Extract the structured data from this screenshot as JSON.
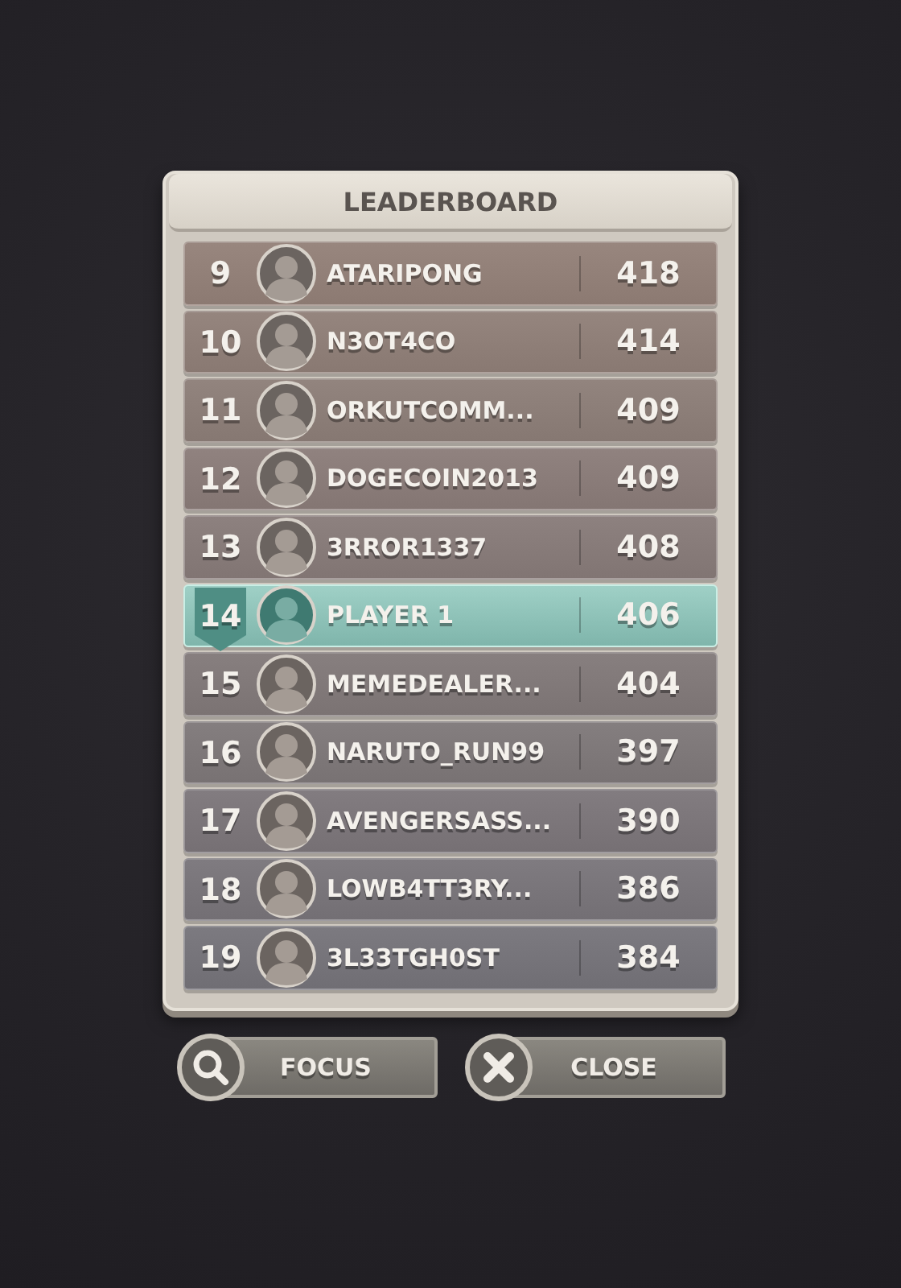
{
  "panel": {
    "title": "LEADERBOARD"
  },
  "rows": [
    {
      "rank": "9",
      "name": "ATARIPONG",
      "score": "418",
      "selected": false
    },
    {
      "rank": "10",
      "name": "N3OT4CO",
      "score": "414",
      "selected": false
    },
    {
      "rank": "11",
      "name": "ORKUTCOMM...",
      "score": "409",
      "selected": false
    },
    {
      "rank": "12",
      "name": "DOGECOIN2013",
      "score": "409",
      "selected": false
    },
    {
      "rank": "13",
      "name": "3RROR1337",
      "score": "408",
      "selected": false
    },
    {
      "rank": "14",
      "name": "PLAYER 1",
      "score": "406",
      "selected": true
    },
    {
      "rank": "15",
      "name": "MEMEDEALER...",
      "score": "404",
      "selected": false
    },
    {
      "rank": "16",
      "name": "NARUTO_RUN99",
      "score": "397",
      "selected": false
    },
    {
      "rank": "17",
      "name": "AVENGERSASS...",
      "score": "390",
      "selected": false
    },
    {
      "rank": "18",
      "name": "LOWB4TT3RY...",
      "score": "386",
      "selected": false
    },
    {
      "rank": "19",
      "name": "3L33TGH0ST",
      "score": "384",
      "selected": false
    }
  ],
  "buttons": [
    {
      "kind": "search",
      "label": "FOCUS"
    },
    {
      "kind": "close",
      "label": "CLOSE"
    }
  ]
}
